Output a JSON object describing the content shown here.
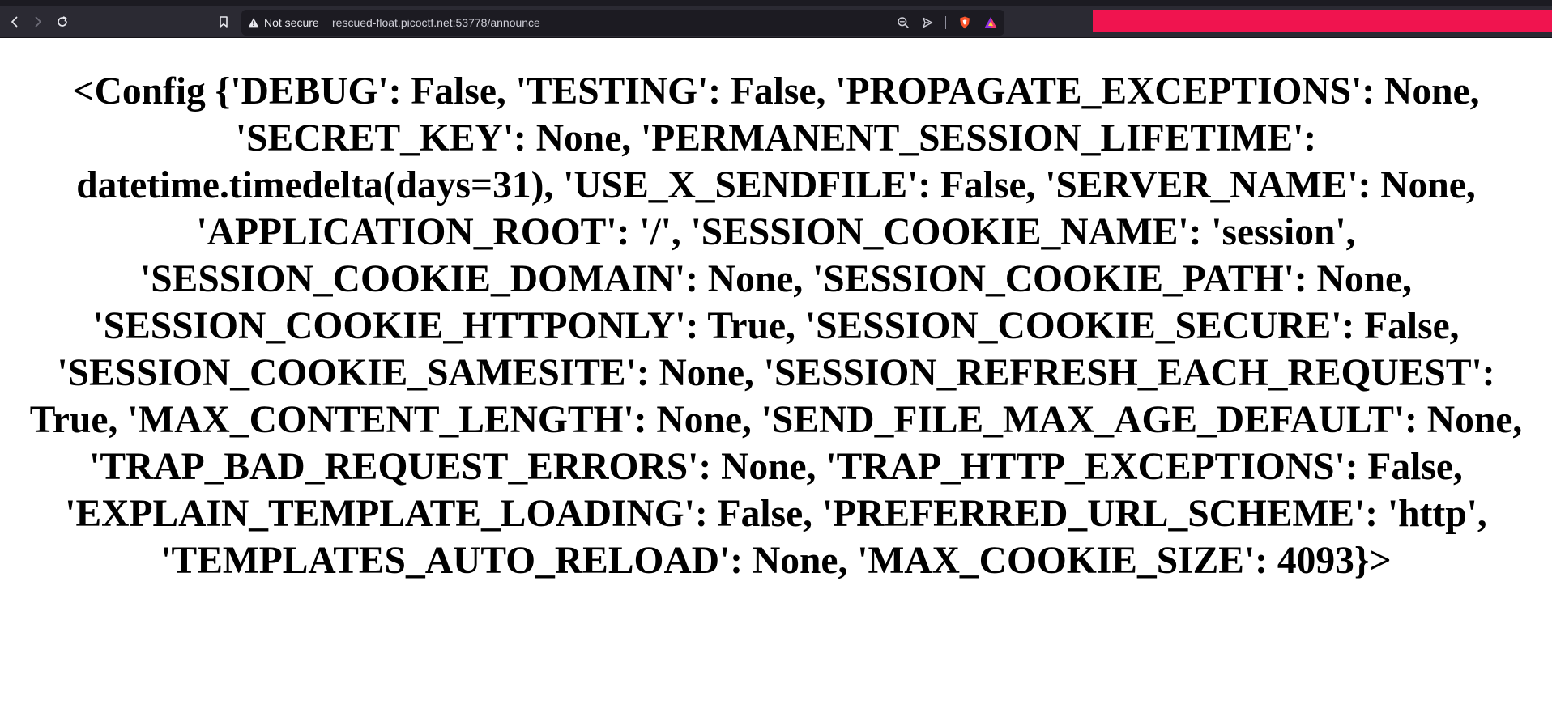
{
  "toolbar": {
    "back_icon": "chevron-left-icon",
    "forward_icon": "chevron-right-icon",
    "reload_icon": "reload-icon",
    "bookmark_icon": "bookmark-icon"
  },
  "urlbar": {
    "security_label": "Not secure",
    "url": "rescued-float.picoctf.net:53778/announce",
    "icons": [
      "warning-triangle-icon",
      "zoom-out-icon",
      "send-icon",
      "brave-shields-icon",
      "brave-rewards-icon"
    ]
  },
  "colors": {
    "toolbar_bg": "#2b2a33",
    "urlbar_bg": "#1c1b22",
    "accent_bar": "#f0144f",
    "page_bg": "#ffffff",
    "text": "#000000"
  },
  "page": {
    "config_text": "<Config {'DEBUG': False, 'TESTING': False, 'PROPAGATE_EXCEPTIONS': None, 'SECRET_KEY': None, 'PERMANENT_SESSION_LIFETIME': datetime.timedelta(days=31), 'USE_X_SENDFILE': False, 'SERVER_NAME': None, 'APPLICATION_ROOT': '/', 'SESSION_COOKIE_NAME': 'session', 'SESSION_COOKIE_DOMAIN': None, 'SESSION_COOKIE_PATH': None, 'SESSION_COOKIE_HTTPONLY': True, 'SESSION_COOKIE_SECURE': False, 'SESSION_COOKIE_SAMESITE': None, 'SESSION_REFRESH_EACH_REQUEST': True, 'MAX_CONTENT_LENGTH': None, 'SEND_FILE_MAX_AGE_DEFAULT': None, 'TRAP_BAD_REQUEST_ERRORS': None, 'TRAP_HTTP_EXCEPTIONS': False, 'EXPLAIN_TEMPLATE_LOADING': False, 'PREFERRED_URL_SCHEME': 'http', 'TEMPLATES_AUTO_RELOAD': None, 'MAX_COOKIE_SIZE': 4093}>"
  }
}
